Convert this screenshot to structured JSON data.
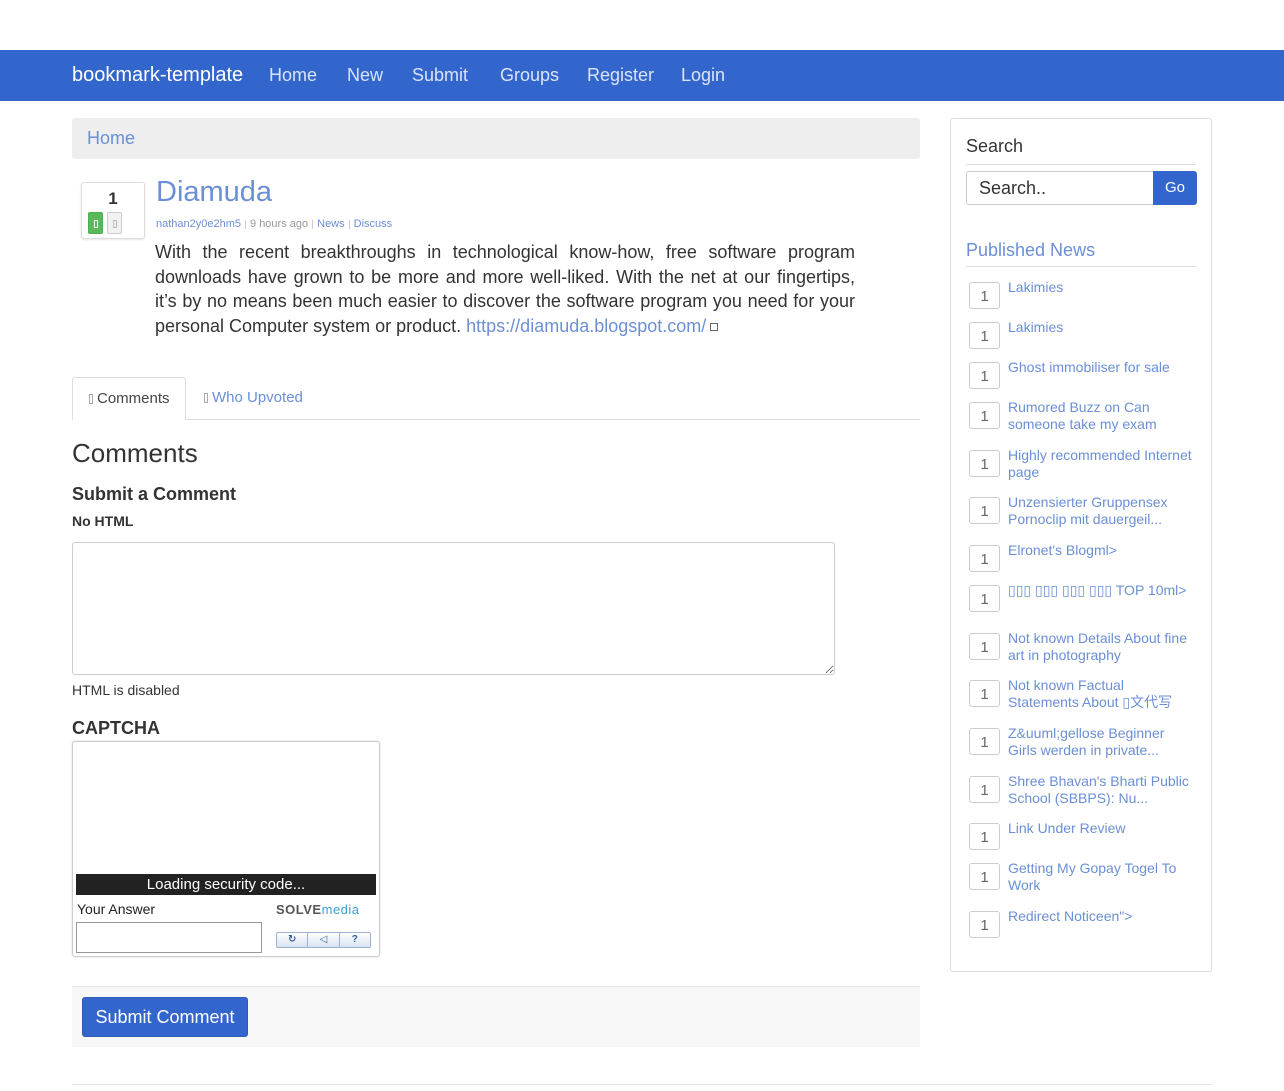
{
  "nav": {
    "brand": "bookmark-template",
    "items": [
      "Home",
      "New",
      "Submit",
      "Groups",
      "Register",
      "Login"
    ]
  },
  "breadcrumb": {
    "home": "Home"
  },
  "post": {
    "votes": "1",
    "title": "Diamuda",
    "author": "nathan2y0e2hm5",
    "time": "9 hours ago",
    "category": "News",
    "discuss": "Discuss",
    "body": "With the recent breakthroughs in technological know-how, free software program downloads have grown to be more and more well-liked. With the net at our fingertips, it’s by no means been much easier to discover the software program you need for your personal Computer system or product.",
    "url": "https://diamuda.blogspot.com/"
  },
  "tabs": {
    "comments": "Comments",
    "who_upvoted": "Who Upvoted"
  },
  "comments": {
    "heading": "Comments",
    "submit_heading": "Submit a Comment",
    "no_html": "No HTML",
    "html_disabled": "HTML is disabled",
    "captcha_heading": "CAPTCHA",
    "captcha_loading": "Loading security code...",
    "your_answer": "Your Answer",
    "solve_logo_a": "SOLVE",
    "solve_logo_b": "media",
    "submit_button": "Submit Comment"
  },
  "sidebar": {
    "search_heading": "Search",
    "search_placeholder": "Search..",
    "go_button": "Go",
    "published_heading": "Published News",
    "news": [
      {
        "count": "1",
        "title": "Lakimies"
      },
      {
        "count": "1",
        "title": "Lakimies"
      },
      {
        "count": "1",
        "title": "Ghost immobiliser for sale"
      },
      {
        "count": "1",
        "title": "Rumored Buzz on Can someone take my exam"
      },
      {
        "count": "1",
        "title": "Highly recommended Internet page"
      },
      {
        "count": "1",
        "title": "Unzensierter Gruppensex Pornoclip mit dauergeil..."
      },
      {
        "count": "1",
        "title": "Elronet's Blogml>"
      },
      {
        "count": "1",
        "title": "▯▯▯ ▯▯▯ ▯▯▯ ▯▯▯ TOP 10ml>"
      },
      {
        "count": "1",
        "title": "Not known Details About fine art in photography"
      },
      {
        "count": "1",
        "title": "Not known Factual Statements About ▯文代写"
      },
      {
        "count": "1",
        "title": "Z&uuml;gellose Beginner Girls werden in private..."
      },
      {
        "count": "1",
        "title": "Shree Bhavan's Bharti Public School (SBBPS): Nu..."
      },
      {
        "count": "1",
        "title": "Link Under Review"
      },
      {
        "count": "1",
        "title": "Getting My Gopay Togel To Work"
      },
      {
        "count": "1",
        "title": "Redirect Noticeen\">"
      }
    ]
  },
  "colors": {
    "brand": "#3366cc",
    "link": "#6b8fd6",
    "upvote": "#5cb85c"
  }
}
